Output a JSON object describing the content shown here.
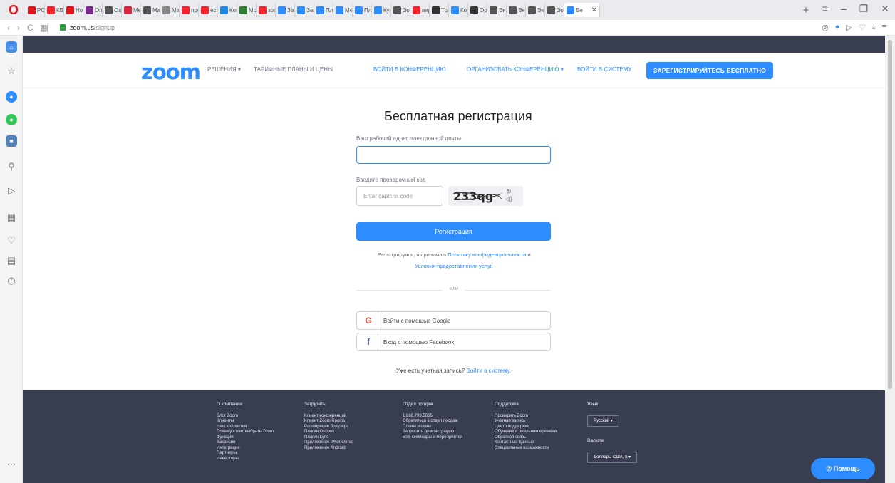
{
  "browser": {
    "tabs": [
      {
        "label": "PC!",
        "color": "#e3131b",
        "icon": "opera-icon"
      },
      {
        "label": "КБП",
        "color": "#f5222d",
        "icon": "yandex-icon"
      },
      {
        "label": "Нов",
        "color": "#e3131b",
        "icon": "mail-icon"
      },
      {
        "label": "Опс",
        "color": "#7a2a8c",
        "icon": "app-icon"
      },
      {
        "label": "Ots",
        "color": "#555555",
        "icon": "doc-icon"
      },
      {
        "label": "Mer",
        "color": "#d7263d",
        "icon": "video-icon"
      },
      {
        "label": "Mar",
        "color": "#555555",
        "icon": "doc-icon"
      },
      {
        "label": "Mar",
        "color": "#888888",
        "icon": "clock-icon"
      },
      {
        "label": "про",
        "color": "#f5222d",
        "icon": "yandex-icon"
      },
      {
        "label": "еси",
        "color": "#f5222d",
        "icon": "yandex-icon"
      },
      {
        "label": "Кон",
        "color": "#1e88e5",
        "icon": "app-icon"
      },
      {
        "label": "Мо",
        "color": "#2e7d32",
        "icon": "app-icon"
      },
      {
        "label": "зоо",
        "color": "#f5222d",
        "icon": "yandex-icon"
      },
      {
        "label": "Запу",
        "color": "#2d8cff",
        "icon": "zoom-icon"
      },
      {
        "label": "Зап",
        "color": "#2d8cff",
        "icon": "zoom-icon"
      },
      {
        "label": "Пла",
        "color": "#2d8cff",
        "icon": "zoom-icon"
      },
      {
        "label": "Ме",
        "color": "#2d8cff",
        "icon": "zoom-icon"
      },
      {
        "label": "Пло",
        "color": "#2d8cff",
        "icon": "zoom-icon"
      },
      {
        "label": "Кур",
        "color": "#2d8cff",
        "icon": "zoom-icon"
      },
      {
        "label": "Экс",
        "color": "#555555",
        "icon": "grid-icon"
      },
      {
        "label": "вир",
        "color": "#f5222d",
        "icon": "yandex-icon"
      },
      {
        "label": "Тра",
        "color": "#333333",
        "icon": "it-icon"
      },
      {
        "label": "Кон",
        "color": "#2d8cff",
        "icon": "zoom-icon"
      },
      {
        "label": "Opc",
        "color": "#333333",
        "icon": "github-icon"
      },
      {
        "label": "Экс",
        "color": "#555555",
        "icon": "grid-icon"
      },
      {
        "label": "Экс",
        "color": "#555555",
        "icon": "grid-icon"
      },
      {
        "label": "Экс",
        "color": "#555555",
        "icon": "grid-icon"
      },
      {
        "label": "Экс",
        "color": "#555555",
        "icon": "grid-icon"
      }
    ],
    "active_tab": {
      "label": "Бе",
      "color": "#2d8cff",
      "icon": "zoom-icon"
    },
    "url_host": "zoom.us",
    "url_path": "/signup"
  },
  "nav": {
    "logo": "zoom",
    "solutions": "РЕШЕНИЯ ▾",
    "pricing": "ТАРИФНЫЕ ПЛАНЫ И ЦЕНЫ",
    "join": "ВОЙТИ В КОНФЕРЕНЦИЮ",
    "host": "ОРГАНИЗОВАТЬ КОНФЕРЕНЦИЮ ▾",
    "signin": "ВОЙТИ В СИСТЕМУ",
    "signup": "ЗАРЕГИСТРИРУЙТЕСЬ БЕСПЛАТНО"
  },
  "form": {
    "title": "Бесплатная регистрация",
    "email_label": "Ваш рабочий адрес электронной почты",
    "email_value": "",
    "captcha_label": "Введите проверочный код",
    "captcha_placeholder": "Enter captcha code",
    "captcha_text": "233qg",
    "register": "Регистрация",
    "terms_prefix": "Регистрируясь, я принимаю",
    "privacy_link": "Политику конфиденциальности",
    "terms_and": "и",
    "terms_link": "Условия предоставления услуг",
    "or": "или",
    "google": "Войти с помощью Google",
    "facebook": "Вход с помощью Facebook",
    "have_account": "Уже есть учетная запись?",
    "signin_link": "Войти в систему."
  },
  "footer": {
    "about": {
      "title": "О компании",
      "items": [
        "Блог Zoom",
        "Клиенты",
        "Наш коллектив",
        "Почему стоит выбрать Zoom",
        "Функции",
        "Вакансии",
        "Интеграция",
        "Партнеры",
        "Инвесторы"
      ]
    },
    "download": {
      "title": "Загрузить",
      "items": [
        "Клиент конференций",
        "Клиент Zoom Rooms",
        "Расширение браузера",
        "Плагин Outlook",
        "Плагин Lync",
        "Приложение iPhone/iPad",
        "Приложение Android"
      ]
    },
    "sales": {
      "title": "Отдел продаж",
      "items": [
        "1.888.799.5866",
        "Обратиться в отдел продаж",
        "Планы и цены",
        "Запросить демонстрацию",
        "Веб-семинары и мероприятия"
      ]
    },
    "support": {
      "title": "Поддержка",
      "items": [
        "Проверить Zoom",
        "Учетная запись",
        "Центр поддержки",
        "Обучение в реальном времени",
        "Обратная связь",
        "Контактные данные",
        "Специальные возможности"
      ]
    },
    "language": {
      "title": "Язык",
      "value": "Русский ▾"
    },
    "currency": {
      "title": "Валюта",
      "value": "Доллары США, $ ▾"
    },
    "help": "⑦ Помощь"
  }
}
